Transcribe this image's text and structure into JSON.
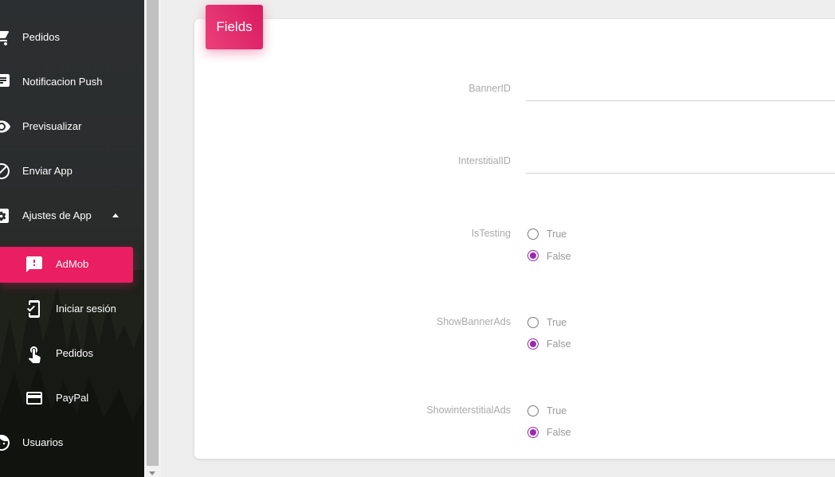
{
  "sidebar": {
    "items": [
      {
        "label": "Pedidos",
        "icon": "shopping-cart-icon"
      },
      {
        "label": "Notificacion Push",
        "icon": "notification-icon"
      },
      {
        "label": "Previsualizar",
        "icon": "eye-icon"
      },
      {
        "label": "Enviar App",
        "icon": "block-icon"
      },
      {
        "label": "Ajustes de App",
        "icon": "settings-icon"
      }
    ],
    "subitems": [
      {
        "label": "AdMob",
        "icon": "feedback-icon",
        "active": true
      },
      {
        "label": "Iniciar sesión",
        "icon": "phonelink-login-icon"
      },
      {
        "label": "Pedidos",
        "icon": "touch-icon"
      },
      {
        "label": "PayPal",
        "icon": "credit-card-icon"
      }
    ],
    "bottom_item": {
      "label": "Usuarios",
      "icon": "face-icon"
    },
    "active_color": "#e91e63"
  },
  "card": {
    "title": "Fields",
    "fields": {
      "banner_id": {
        "label": "BannerID",
        "value": ""
      },
      "interstitial_id": {
        "label": "InterstitialID",
        "value": ""
      },
      "is_testing": {
        "label": "IsTesting",
        "options": [
          "True",
          "False"
        ],
        "selected": "False"
      },
      "show_banner_ads": {
        "label": "ShowBannerAds",
        "options": [
          "True",
          "False"
        ],
        "selected": "False"
      },
      "show_interstitial_ads": {
        "label": "ShowinterstitialAds",
        "options": [
          "True",
          "False"
        ],
        "selected": "False"
      }
    }
  },
  "colors": {
    "accent": "#e91e63",
    "radio": "#9c27b0"
  }
}
